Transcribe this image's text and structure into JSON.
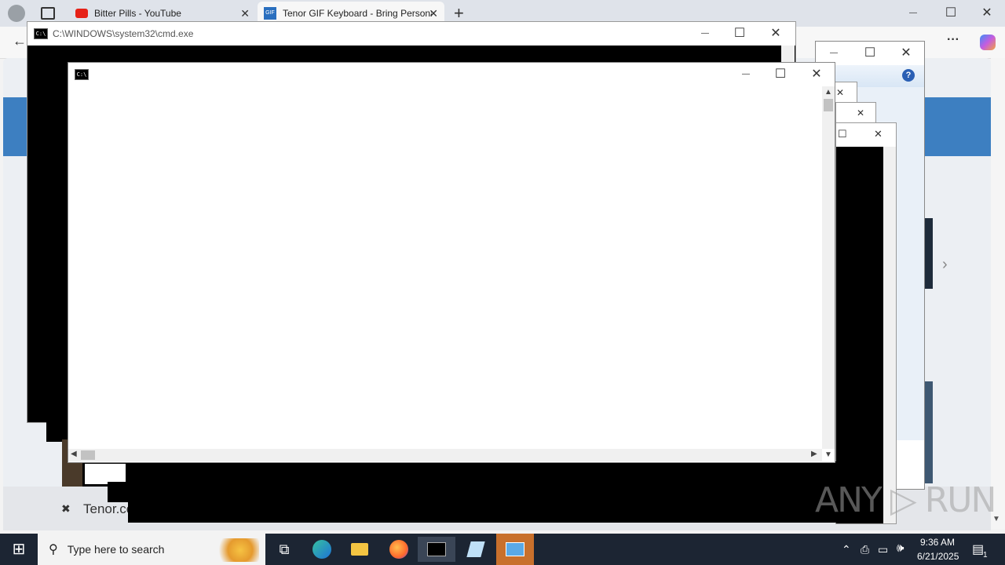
{
  "browser": {
    "tabs": [
      {
        "title": "Bitter Pills - YouTube",
        "icon": "youtube-icon"
      },
      {
        "title": "Tenor GIF Keyboard - Bring Personality",
        "icon": "gif-icon"
      }
    ],
    "new_tab_glyph": "+",
    "tab_close_glyph": "✕",
    "more_glyph": "···",
    "page_fragment": "Tenor.co",
    "dismiss_glyph": "✖"
  },
  "cmd_main": {
    "title": "C:\\WINDOWS\\system32\\cmd.exe"
  },
  "cmd_front": {
    "title": ""
  },
  "window_controls": {
    "minimize": "—",
    "maximize": "☐",
    "close": "✕"
  },
  "help_glyph": "?",
  "watermark": "ANY ▷ RUN",
  "taskbar": {
    "start_glyph": "⊞",
    "search_placeholder": "Type here to search",
    "time": "9:36 AM",
    "date": "6/21/2025",
    "notification_count": "1"
  },
  "colors": {
    "taskbar": "#1c2533",
    "accent": "#3d7fc1"
  }
}
